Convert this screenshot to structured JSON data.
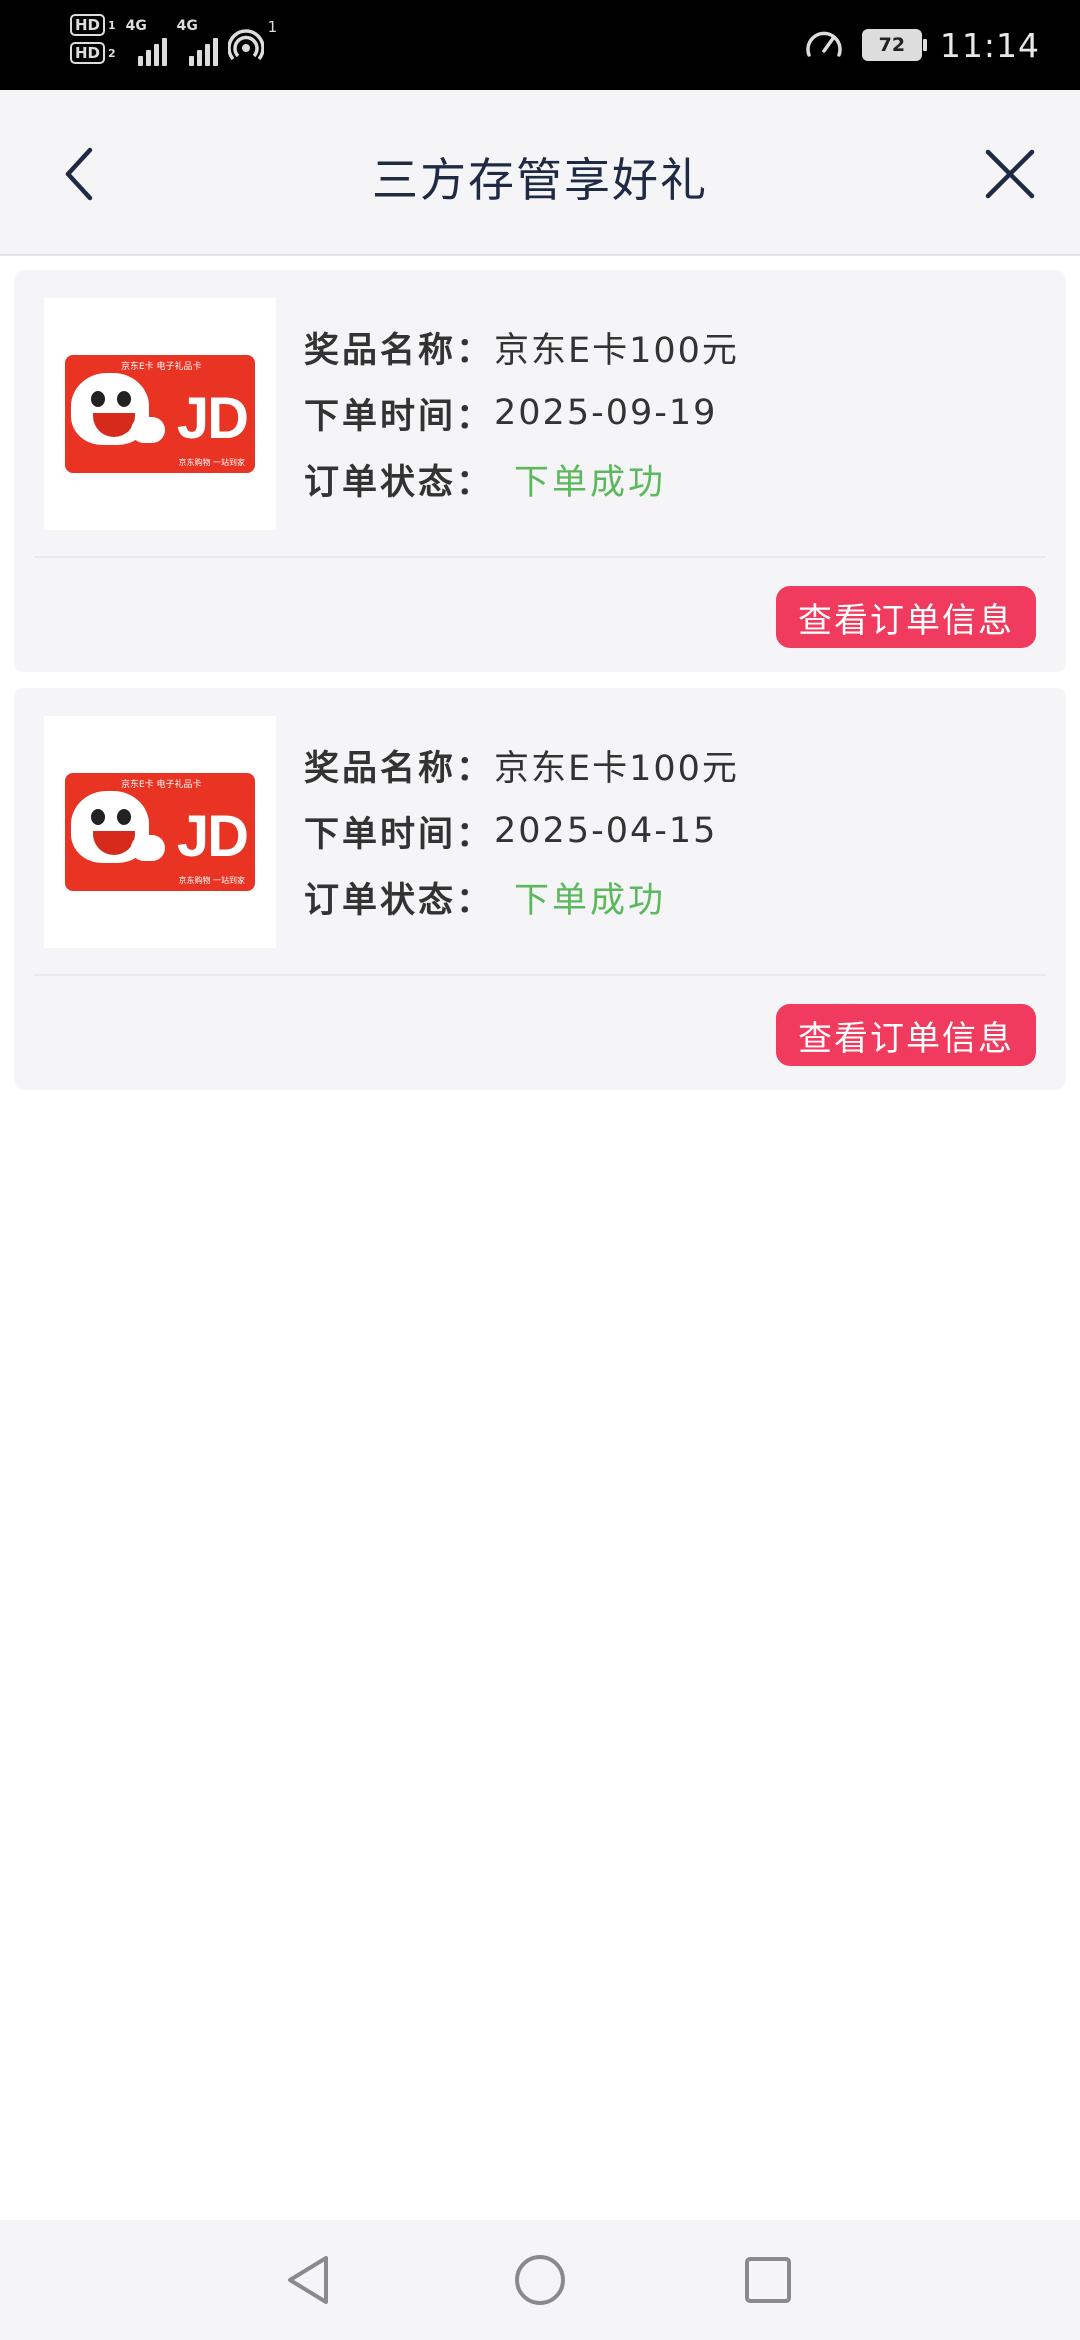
{
  "status_bar": {
    "sim1": "HD",
    "sim1_num": "1",
    "sim2": "HD",
    "sim2_num": "2",
    "net1": "4G",
    "net2": "4G",
    "hotspot_count": "1",
    "battery": "72",
    "time": "11:14"
  },
  "header": {
    "title": "三方存管享好礼"
  },
  "orders": [
    {
      "prize_label": "奖品名称：",
      "prize_value": "京东E卡100元",
      "time_label": "下单时间：",
      "time_value": "2025-09-19",
      "status_label": "订单状态：",
      "status_value": "下单成功",
      "button_label": "查看订单信息"
    },
    {
      "prize_label": "奖品名称：",
      "prize_value": "京东E卡100元",
      "time_label": "下单时间：",
      "time_value": "2025-04-15",
      "status_label": "订单状态：",
      "status_value": "下单成功",
      "button_label": "查看订单信息"
    }
  ],
  "card_image": {
    "brand_text": "京东E卡 电子礼品卡",
    "logo_text": "JD",
    "slogan": "京东购物 一站到家"
  },
  "colors": {
    "status_success": "#5cb85c",
    "button_bg": "#f03b5e",
    "title": "#1f2a44"
  }
}
